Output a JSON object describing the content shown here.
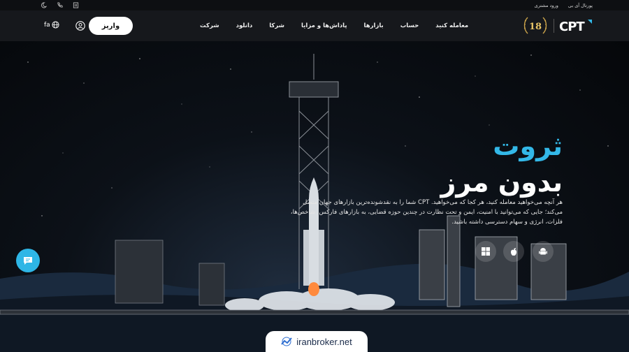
{
  "topbar": {
    "links": [
      "پورتال آی بی",
      "ورود مشتری"
    ],
    "icons": [
      "moon-icon",
      "phone-icon",
      "building-icon"
    ]
  },
  "nav": {
    "lang_label": "fa",
    "deposit_label": "واریز",
    "menu": [
      "معامله کنید",
      "حساب",
      "بازارها",
      "پاداش‌ها و مزایا",
      "شرکا",
      "دانلود",
      "شرکت"
    ],
    "badge_number": "18",
    "logo_text": "CPT"
  },
  "hero": {
    "title_line1": "ثروت",
    "title_line2": "بدون مرز",
    "description": "هر آنچه می‌خواهید معامله کنید، هر کجا که می‌خواهید. CPT شما را به نقدشونده‌ترین بازارهای جهان متصل می‌کند؛ جایی که می‌توانید با امنیت، ایمن و تحت نظارت در چندین حوزه قضایی، به بازارهای فارکس، شاخص‌ها، فلزات، انرژی و سهام دسترسی داشته باشید.",
    "app_icons": [
      "windows-icon",
      "apple-icon",
      "android-icon"
    ]
  },
  "watermark": {
    "text": "iranbroker.net"
  },
  "colors": {
    "accent": "#33b8e8",
    "nav_bg": "#16181c"
  }
}
